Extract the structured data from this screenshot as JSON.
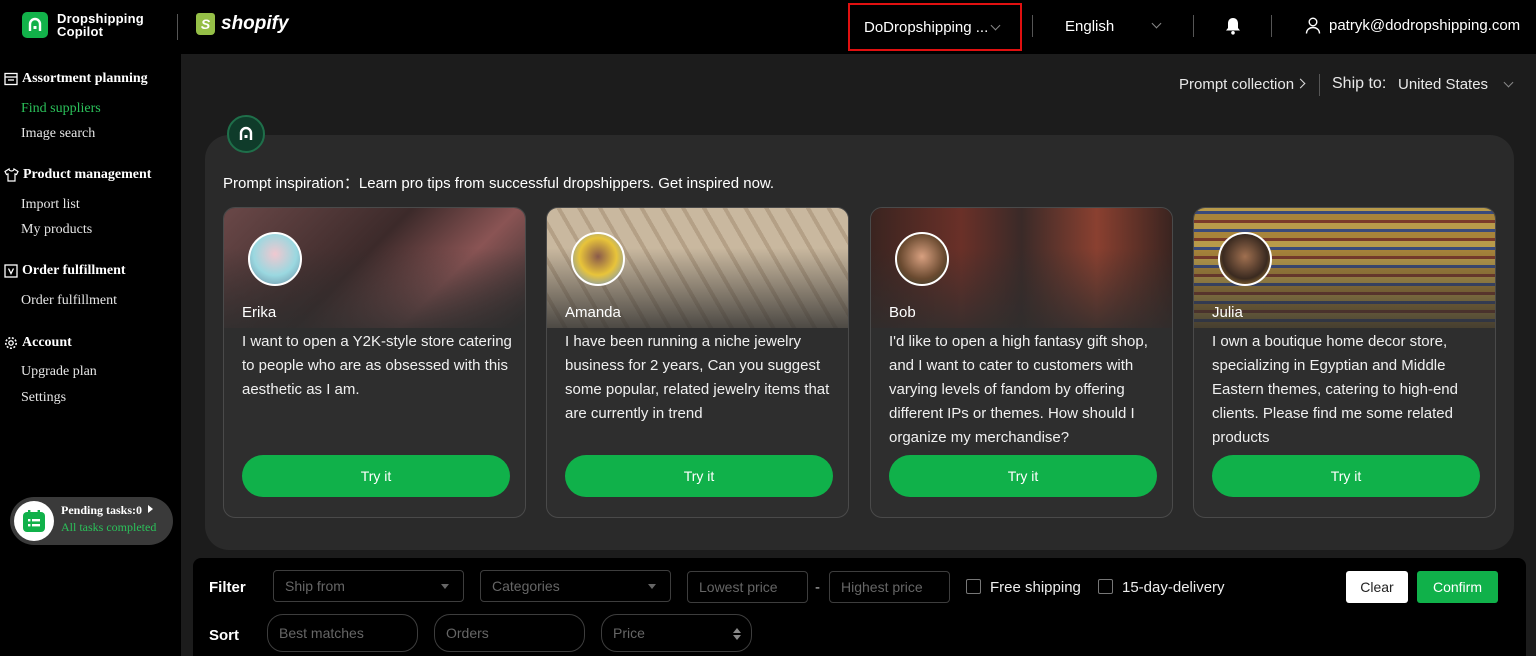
{
  "header": {
    "brand_line1": "Dropshipping",
    "brand_line2": "Copilot",
    "platform": "shopify",
    "store": "DoDropshipping ...",
    "language": "English",
    "user_email": "patryk@dodropshipping.com"
  },
  "sidebar": {
    "sections": [
      {
        "title": "Assortment planning",
        "icon": "clipboard-icon",
        "items": [
          {
            "label": "Find suppliers",
            "active": true
          },
          {
            "label": "Image search",
            "active": false
          }
        ]
      },
      {
        "title": "Product management",
        "icon": "shirt-icon",
        "items": [
          {
            "label": "Import list",
            "active": false
          },
          {
            "label": "My products",
            "active": false
          }
        ]
      },
      {
        "title": "Order fulfillment",
        "icon": "order-icon",
        "items": [
          {
            "label": "Order fulfillment",
            "active": false
          }
        ]
      },
      {
        "title": "Account",
        "icon": "gear-icon",
        "items": [
          {
            "label": "Upgrade plan",
            "active": false
          },
          {
            "label": "Settings",
            "active": false
          }
        ]
      }
    ],
    "pending": {
      "title": "Pending tasks:0",
      "status": "All tasks completed"
    }
  },
  "main": {
    "prompt_collection": "Prompt collection",
    "ship_to_label": "Ship to:",
    "ship_to_value": "United States",
    "inspiration": "Prompt inspiration：Learn pro tips from successful dropshippers. Get inspired now.",
    "cards": [
      {
        "name": "Erika",
        "text": "I want to open a Y2K-style store catering to people who are as obsessed with this aesthetic as I am.",
        "button": "Try it",
        "bg": "#5b3a3a"
      },
      {
        "name": "Amanda",
        "text": "I have been running a niche jewelry business for 2 years, Can you suggest some popular, related jewelry items that are currently in trend",
        "button": "Try it",
        "bg": "#b9a58c"
      },
      {
        "name": "Bob",
        "text": "I'd like to open a high fantasy gift shop, and I want to cater to customers with varying levels of fandom by offering different IPs or themes. How should I organize my merchandise?",
        "button": "Try it",
        "bg": "#4a2a22"
      },
      {
        "name": "Julia",
        "text": "I own a boutique home decor store, specializing in Egyptian and Middle Eastern themes, catering to high-end clients. Please find me some related products",
        "button": "Try it",
        "bg": "#9a7a3a"
      }
    ]
  },
  "filter": {
    "filter_label": "Filter",
    "ship_from_placeholder": "Ship from",
    "categories_placeholder": "Categories",
    "lowest_price_placeholder": "Lowest price",
    "price_dash": "-",
    "highest_price_placeholder": "Highest price",
    "free_shipping": "Free shipping",
    "fast_delivery": "15-day-delivery",
    "clear": "Clear",
    "confirm": "Confirm",
    "sort_label": "Sort",
    "sort_options": [
      "Best matches",
      "Orders",
      "Price"
    ]
  }
}
